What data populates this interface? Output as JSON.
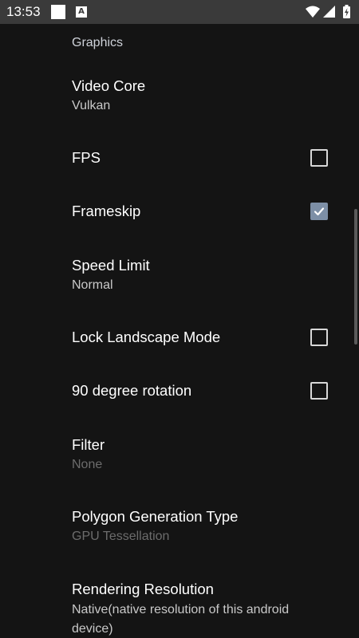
{
  "status_bar": {
    "time": "13:53",
    "notification_icons": [
      "blank-square-icon",
      "a-notification-icon"
    ],
    "system_icons": [
      "wifi-icon",
      "cell-signal-icon",
      "battery-charging-icon"
    ],
    "a_glyph": "A"
  },
  "settings": {
    "section_header": "Graphics",
    "items": [
      {
        "title": "Video Core",
        "summary": "Vulkan"
      },
      {
        "title": "FPS",
        "checked": false
      },
      {
        "title": "Frameskip",
        "checked": true
      },
      {
        "title": "Speed Limit",
        "summary": "Normal"
      },
      {
        "title": "Lock Landscape Mode",
        "checked": false
      },
      {
        "title": "90 degree rotation",
        "checked": false
      },
      {
        "title": "Filter",
        "summary": "None",
        "disabled": true
      },
      {
        "title": "Polygon Generation Type",
        "summary": "GPU Tessellation",
        "disabled": true
      },
      {
        "title": "Rendering Resolution",
        "summary": "Native(native resolution of this android device)"
      }
    ]
  },
  "colors": {
    "background": "#141414",
    "status_bar": "#3a3a3a",
    "accent_checkbox": "#7d8fa6"
  }
}
